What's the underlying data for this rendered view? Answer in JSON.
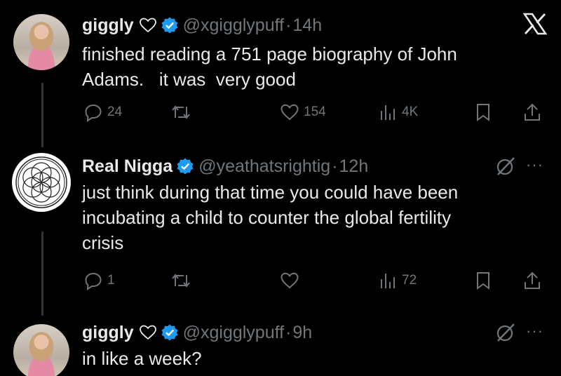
{
  "tweets": [
    {
      "display_name": "giggly",
      "handle": "@xgigglypuff",
      "time": "14h",
      "text_line1": "finished reading a 751 page biography of John",
      "text_line2": "Adams.   it was  very good",
      "replies": "24",
      "likes": "154",
      "views": "4K"
    },
    {
      "display_name": "Real Nigga",
      "handle": "@yeathatsrightig",
      "time": "12h",
      "text_line1": "just think during that time you could have been",
      "text_line2": "incubating a child to counter the global fertility",
      "text_line3": "crisis",
      "replies": "1",
      "views": "72"
    },
    {
      "display_name": "giggly",
      "handle": "@xgigglypuff",
      "time": "9h",
      "text_line1": "in like a week?"
    }
  ],
  "icons": {
    "close": "x-logo-icon",
    "verified_color": "#1d9bf0"
  }
}
